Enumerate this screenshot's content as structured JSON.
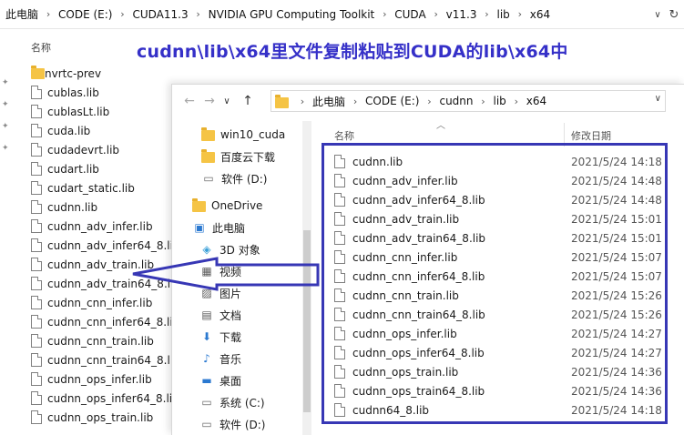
{
  "caption": "cudnn\\lib\\x64里文件复制粘贴到CUDA的lib\\x64中",
  "colors": {
    "accent": "#3737b5",
    "caption": "#3530c8",
    "folder": "#f5c445"
  },
  "back_window": {
    "breadcrumbs": [
      "此电脑",
      "CODE (E:)",
      "CUDA11.3",
      "NVIDIA GPU Computing Toolkit",
      "CUDA",
      "v11.3",
      "lib",
      "x64"
    ],
    "column_name": "名称",
    "files": [
      {
        "name": "nvrtc-prev",
        "type": "folder"
      },
      {
        "name": "cublas.lib",
        "type": "file"
      },
      {
        "name": "cublasLt.lib",
        "type": "file"
      },
      {
        "name": "cuda.lib",
        "type": "file"
      },
      {
        "name": "cudadevrt.lib",
        "type": "file"
      },
      {
        "name": "cudart.lib",
        "type": "file"
      },
      {
        "name": "cudart_static.lib",
        "type": "file"
      },
      {
        "name": "cudnn.lib",
        "type": "file"
      },
      {
        "name": "cudnn_adv_infer.lib",
        "type": "file"
      },
      {
        "name": "cudnn_adv_infer64_8.lib",
        "type": "file"
      },
      {
        "name": "cudnn_adv_train.lib",
        "type": "file"
      },
      {
        "name": "cudnn_adv_train64_8.lib",
        "type": "file"
      },
      {
        "name": "cudnn_cnn_infer.lib",
        "type": "file"
      },
      {
        "name": "cudnn_cnn_infer64_8.lib",
        "type": "file"
      },
      {
        "name": "cudnn_cnn_train.lib",
        "type": "file"
      },
      {
        "name": "cudnn_cnn_train64_8.lib",
        "type": "file"
      },
      {
        "name": "cudnn_ops_infer.lib",
        "type": "file"
      },
      {
        "name": "cudnn_ops_infer64_8.lib",
        "type": "file"
      },
      {
        "name": "cudnn_ops_train.lib",
        "type": "file"
      }
    ]
  },
  "front_window": {
    "nav": {
      "back": "←",
      "forward": "→",
      "recent": "∨",
      "up": "↑"
    },
    "breadcrumbs": [
      "此电脑",
      "CODE (E:)",
      "cudnn",
      "lib",
      "x64"
    ],
    "sidebar": [
      {
        "label": "win10_cuda",
        "icon": "folder-icon"
      },
      {
        "label": "百度云下载",
        "icon": "folder-icon"
      },
      {
        "label": "软件 (D:)",
        "icon": "drive-icon"
      },
      {
        "label": "OneDrive",
        "icon": "folder-icon"
      },
      {
        "label": "此电脑",
        "icon": "computer-icon"
      },
      {
        "label": "3D 对象",
        "icon": "cube-icon"
      },
      {
        "label": "视频",
        "icon": "video-icon"
      },
      {
        "label": "图片",
        "icon": "picture-icon"
      },
      {
        "label": "文档",
        "icon": "document-icon"
      },
      {
        "label": "下载",
        "icon": "download-icon"
      },
      {
        "label": "音乐",
        "icon": "music-icon"
      },
      {
        "label": "桌面",
        "icon": "desktop-icon"
      },
      {
        "label": "系统 (C:)",
        "icon": "drive-icon"
      },
      {
        "label": "软件 (D:)",
        "icon": "drive-icon"
      }
    ],
    "columns": {
      "name": "名称",
      "date": "修改日期"
    },
    "files": [
      {
        "name": "cudnn.lib",
        "date": "2021/5/24 14:18"
      },
      {
        "name": "cudnn_adv_infer.lib",
        "date": "2021/5/24 14:48"
      },
      {
        "name": "cudnn_adv_infer64_8.lib",
        "date": "2021/5/24 14:48"
      },
      {
        "name": "cudnn_adv_train.lib",
        "date": "2021/5/24 15:01"
      },
      {
        "name": "cudnn_adv_train64_8.lib",
        "date": "2021/5/24 15:01"
      },
      {
        "name": "cudnn_cnn_infer.lib",
        "date": "2021/5/24 15:07"
      },
      {
        "name": "cudnn_cnn_infer64_8.lib",
        "date": "2021/5/24 15:07"
      },
      {
        "name": "cudnn_cnn_train.lib",
        "date": "2021/5/24 15:26"
      },
      {
        "name": "cudnn_cnn_train64_8.lib",
        "date": "2021/5/24 15:26"
      },
      {
        "name": "cudnn_ops_infer.lib",
        "date": "2021/5/24 14:27"
      },
      {
        "name": "cudnn_ops_infer64_8.lib",
        "date": "2021/5/24 14:27"
      },
      {
        "name": "cudnn_ops_train.lib",
        "date": "2021/5/24 14:36"
      },
      {
        "name": "cudnn_ops_train64_8.lib",
        "date": "2021/5/24 14:36"
      },
      {
        "name": "cudnn64_8.lib",
        "date": "2021/5/24 14:18"
      }
    ]
  }
}
